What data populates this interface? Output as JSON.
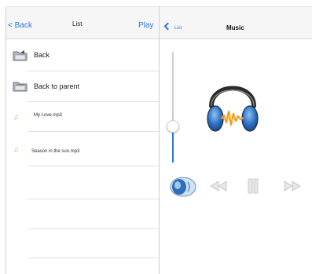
{
  "list_screen": {
    "nav": {
      "back_label": "< Back",
      "title": "List",
      "play_label": "Play"
    },
    "items": [
      {
        "label": "Back",
        "icon": "folder-icon"
      },
      {
        "label": "Back to parent",
        "icon": "folder-icon"
      },
      {
        "label": "My Love.mp3",
        "icon": "music-note-icon"
      },
      {
        "label": "Season in the sun.mp3",
        "icon": "music-note-icon"
      }
    ]
  },
  "music_screen": {
    "nav": {
      "back_label": "List",
      "title": "Music"
    },
    "volume_level": 0.33,
    "artwork": "headphones-icon",
    "controls": [
      "speaker-icon",
      "rewind-icon",
      "pause-icon",
      "fast-forward-icon"
    ]
  },
  "colors": {
    "accent": "#2a7bd6",
    "note": "#c9b400",
    "navbar": "#f6f6f6"
  }
}
